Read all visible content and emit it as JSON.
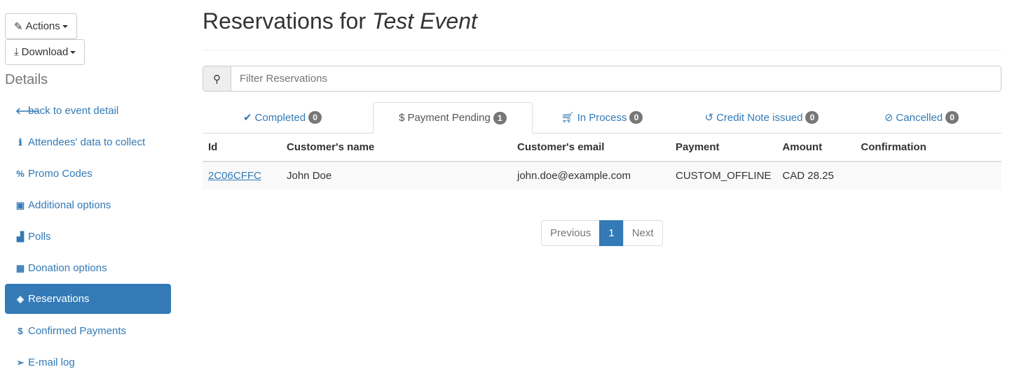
{
  "sidebar": {
    "actions_label": "Actions",
    "download_label": "Download",
    "heading": "Details",
    "items": [
      {
        "label": "back to event detail",
        "icon": "arrow-left-icon"
      },
      {
        "label": "Attendees' data to collect",
        "icon": "info-circle-icon"
      },
      {
        "label": "Promo Codes",
        "icon": "percent-icon"
      },
      {
        "label": "Additional options",
        "icon": "money-icon"
      },
      {
        "label": "Polls",
        "icon": "bar-chart-icon"
      },
      {
        "label": "Donation options",
        "icon": "gift-icon"
      },
      {
        "label": "Reservations",
        "icon": "ticket-icon",
        "active": true
      },
      {
        "label": "Confirmed Payments",
        "icon": "dollar-icon"
      },
      {
        "label": "E-mail log",
        "icon": "paper-plane-icon"
      }
    ]
  },
  "main": {
    "title_prefix": "Reservations for",
    "event_name": "Test Event",
    "search_placeholder": "Filter Reservations",
    "tabs": [
      {
        "label": "Completed",
        "count": "0"
      },
      {
        "label": "Payment Pending",
        "count": "1",
        "active": true
      },
      {
        "label": "In Process",
        "count": "0"
      },
      {
        "label": "Credit Note issued",
        "count": "0"
      },
      {
        "label": "Cancelled",
        "count": "0"
      }
    ],
    "columns": [
      "Id",
      "Customer's name",
      "Customer's email",
      "Payment",
      "Amount",
      "Confirmation"
    ],
    "rows": [
      [
        "2C06CFFC",
        "John Doe",
        "john.doe@example.com",
        "CUSTOM_OFFLINE",
        "CAD 28.25",
        ""
      ]
    ],
    "pagination": {
      "previous": "Previous",
      "current": "1",
      "next": "Next"
    }
  },
  "colors": {
    "primary": "#337ab7",
    "badge": "#777777"
  }
}
